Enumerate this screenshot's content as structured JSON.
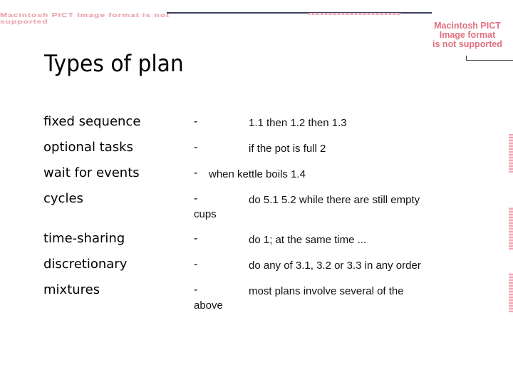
{
  "placeholders": {
    "left_image_text": "Macintosh PICT Image format is not supported",
    "right_image_text": [
      "Macintosh PICT",
      "Image format",
      "is not supported"
    ]
  },
  "slide": {
    "title": "Types of plan",
    "items": [
      {
        "term": "fixed sequence",
        "dash": "-",
        "desc": "1.1 then 1.2 then 1.3",
        "wrap": ""
      },
      {
        "term": "optional tasks",
        "dash": "-",
        "desc": "if the pot is full 2",
        "wrap": ""
      },
      {
        "term": "wait for events",
        "dash": "-",
        "desc": "when kettle boils 1.4",
        "wrap": ""
      },
      {
        "term": "cycles",
        "dash": "-",
        "desc": "do 5.1 5.2 while there are still empty",
        "wrap": "cups"
      },
      {
        "term": "time-sharing",
        "dash": "-",
        "desc": "do 1; at the same time ...",
        "wrap": ""
      },
      {
        "term": "discretionary",
        "dash": "-",
        "desc": "do any of 3.1, 3.2 or 3.3 in any order",
        "wrap": ""
      },
      {
        "term": "mixtures",
        "dash": "-",
        "desc": "most plans involve several of the",
        "wrap": "above"
      }
    ]
  },
  "colors": {
    "placeholder_text": "#e07080",
    "rule": "#3a3f5c"
  }
}
